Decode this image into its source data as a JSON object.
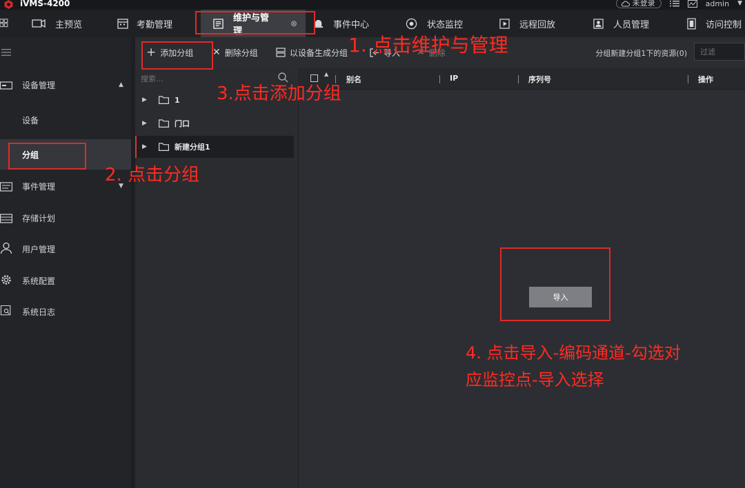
{
  "app": {
    "title": "iVMS-4200",
    "login_status": "未登录",
    "user": "admin"
  },
  "tabs": [
    {
      "label": "主预览"
    },
    {
      "label": "考勤管理"
    },
    {
      "label": "维护与管理"
    },
    {
      "label": "事件中心"
    },
    {
      "label": "状态监控"
    },
    {
      "label": "远程回放"
    },
    {
      "label": "人员管理"
    },
    {
      "label": "访问控制"
    }
  ],
  "sidebar": {
    "items": [
      {
        "label": "设备管理"
      },
      {
        "label": "设备"
      },
      {
        "label": "分组"
      },
      {
        "label": "事件管理"
      },
      {
        "label": "存储计划"
      },
      {
        "label": "用户管理"
      },
      {
        "label": "系统配置"
      },
      {
        "label": "系统日志"
      }
    ]
  },
  "toolbar": {
    "add_group": "添加分组",
    "delete_group": "删除分组",
    "generate_group": "以设备生成分组",
    "import": "导入",
    "delete": "删除",
    "resource_label": "分组新建分组1下的资源(0)",
    "filter_placeholder": "过滤"
  },
  "tree": {
    "search_placeholder": "搜索...",
    "nodes": [
      {
        "label": "1"
      },
      {
        "label": "门口"
      },
      {
        "label": "新建分组1"
      }
    ]
  },
  "table": {
    "columns": [
      "别名",
      "IP",
      "序列号",
      "操作"
    ]
  },
  "main": {
    "import_button": "导入"
  },
  "annotations": {
    "step1": "1. 点击维护与管理",
    "step2": "2. 点击分组",
    "step3": "3.点击添加分组",
    "step4_line1": "4. 点击导入-编码通道-勾选对",
    "step4_line2": "应监控点-导入选择"
  },
  "colors": {
    "highlight": "#e02b28",
    "annotation": "#ff2b22",
    "accent": "#d53a35"
  }
}
